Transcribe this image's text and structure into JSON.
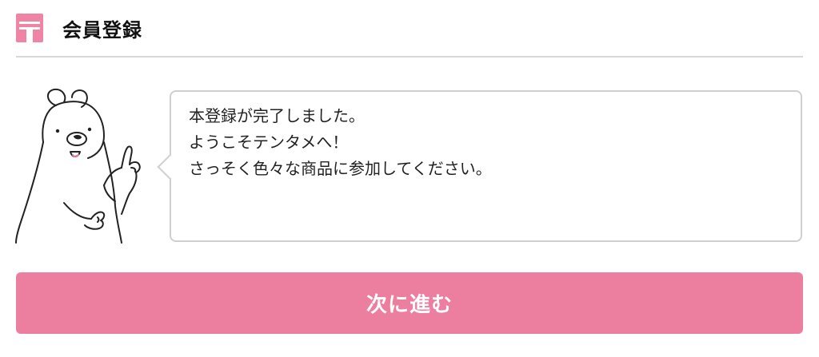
{
  "header": {
    "title": "会員登録",
    "icon": "pink-card-icon"
  },
  "message": {
    "lines": [
      "本登録が完了しました。",
      "ようこそテンタメへ！",
      "さっそく色々な商品に参加してください。"
    ]
  },
  "mascot": {
    "icon": "bear-mascot-icon"
  },
  "actions": {
    "next_label": "次に進む"
  },
  "colors": {
    "accent": "#ec7e9f",
    "icon_pink": "#ef84a5",
    "divider": "#d8d8d8",
    "bubble_border": "#cfcfcf"
  }
}
